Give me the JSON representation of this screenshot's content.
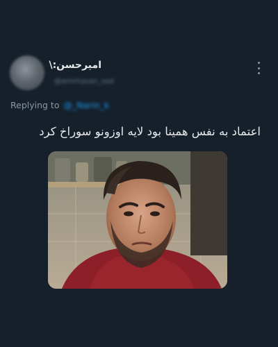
{
  "tweet": {
    "author": {
      "display_name": "امیرحسن:\\",
      "handle": "@amirhasan_sad"
    },
    "replying_to": {
      "prefix": "Replying to",
      "handle": "@_Narin_k"
    },
    "text": "اعتماد به نفس همینا بود لایه اوزونو سوراخ کرد",
    "media": {
      "kind": "image",
      "subject": "man-red-sweater"
    },
    "more_icon": "more-vertical-icon"
  },
  "colors": {
    "background": "#15202b",
    "primary_text": "#e7e9ea",
    "secondary_text": "#8b98a5",
    "link": "#1d9bf0"
  }
}
